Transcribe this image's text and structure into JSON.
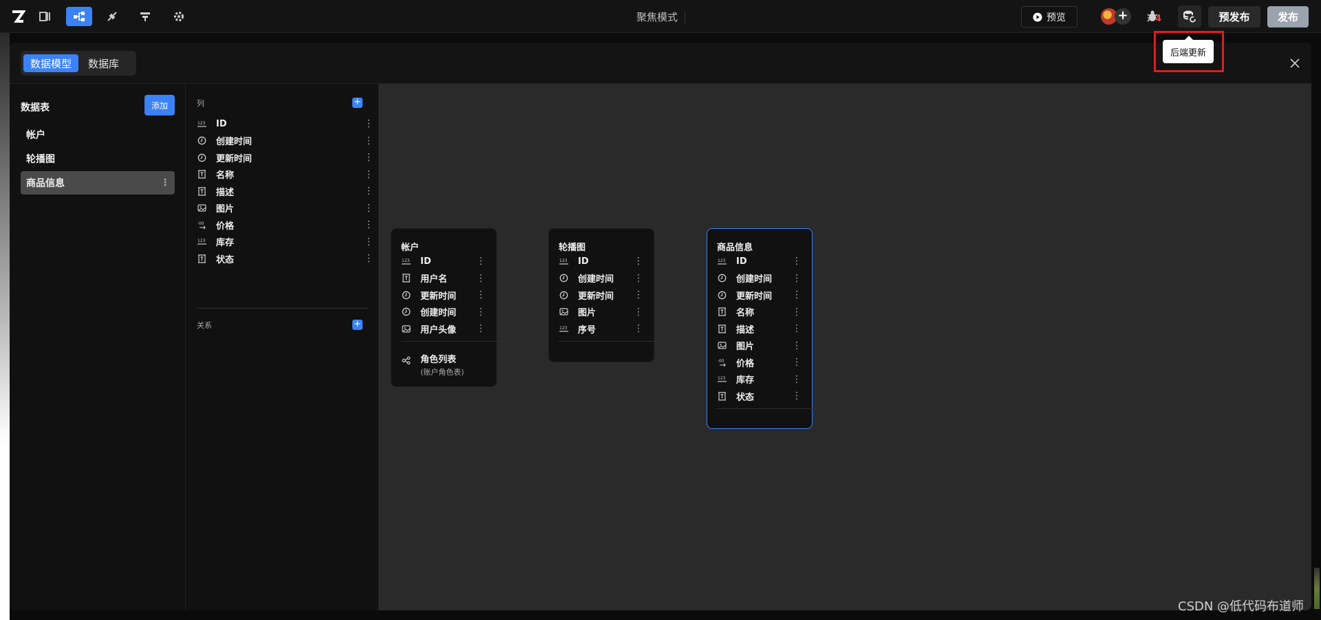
{
  "topbar": {
    "focus_mode": "聚焦模式",
    "preview_label": "预览",
    "bug_count": "4",
    "prepublish_label": "预发布",
    "publish_label": "发布",
    "tooltip": "后端更新"
  },
  "modal": {
    "tabs": [
      {
        "label": "数据模型",
        "active": true
      },
      {
        "label": "数据库",
        "active": false
      }
    ]
  },
  "tables_panel": {
    "title": "数据表",
    "add_label": "添加",
    "items": [
      {
        "label": "帐户"
      },
      {
        "label": "轮播图"
      },
      {
        "label": "商品信息",
        "selected": true
      }
    ]
  },
  "columns_panel": {
    "columns_label": "列",
    "relations_label": "关系",
    "columns": [
      {
        "name": "ID",
        "type": "number"
      },
      {
        "name": "创建时间",
        "type": "time"
      },
      {
        "name": "更新时间",
        "type": "time"
      },
      {
        "name": "名称",
        "type": "text"
      },
      {
        "name": "描述",
        "type": "text"
      },
      {
        "name": "图片",
        "type": "image"
      },
      {
        "name": "价格",
        "type": "decimal"
      },
      {
        "name": "库存",
        "type": "number"
      },
      {
        "name": "状态",
        "type": "text"
      }
    ]
  },
  "canvas": {
    "cards": [
      {
        "title": "帐户",
        "fields": [
          {
            "name": "ID",
            "type": "number"
          },
          {
            "name": "用户名",
            "type": "text"
          },
          {
            "name": "更新时间",
            "type": "time"
          },
          {
            "name": "创建时间",
            "type": "time"
          },
          {
            "name": "用户头像",
            "type": "image"
          }
        ],
        "relation": {
          "name": "角色列表",
          "sub": "(账户角色表)"
        }
      },
      {
        "title": "轮播图",
        "fields": [
          {
            "name": "ID",
            "type": "number"
          },
          {
            "name": "创建时间",
            "type": "time"
          },
          {
            "name": "更新时间",
            "type": "time"
          },
          {
            "name": "图片",
            "type": "image"
          },
          {
            "name": "序号",
            "type": "number"
          }
        ]
      },
      {
        "title": "商品信息",
        "selected": true,
        "fields": [
          {
            "name": "ID",
            "type": "number"
          },
          {
            "name": "创建时间",
            "type": "time"
          },
          {
            "name": "更新时间",
            "type": "time"
          },
          {
            "name": "名称",
            "type": "text"
          },
          {
            "name": "描述",
            "type": "text"
          },
          {
            "name": "图片",
            "type": "image"
          },
          {
            "name": "价格",
            "type": "decimal"
          },
          {
            "name": "库存",
            "type": "number"
          },
          {
            "name": "状态",
            "type": "text"
          }
        ]
      }
    ]
  },
  "watermark": "CSDN @低代码布道师",
  "colors": {
    "accent": "#3b82f6",
    "highlight": "#e11d1d",
    "bug": "#ef4444"
  }
}
